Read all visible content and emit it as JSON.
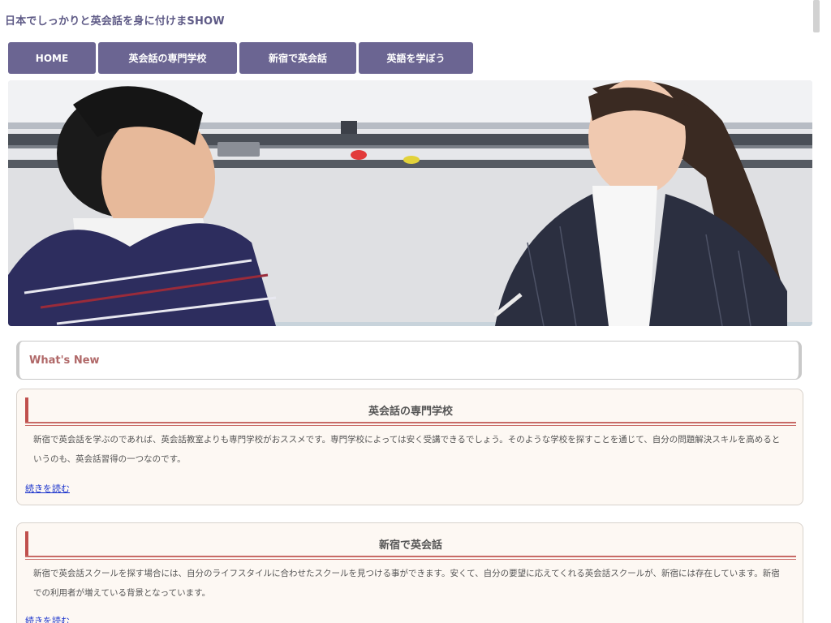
{
  "site": {
    "title": "日本でしっかりと英会話を身に付けまSHOW"
  },
  "nav": [
    {
      "label": "HOME"
    },
    {
      "label": "英会話の専門学校"
    },
    {
      "label": "新宿で英会話"
    },
    {
      "label": "英語を学ぼう"
    }
  ],
  "hero": {
    "image": "two-people-talking-classroom"
  },
  "news": {
    "heading": "What's New"
  },
  "articles": [
    {
      "title": "英会話の専門学校",
      "body": "新宿で英会話を学ぶのであれば、英会話教室よりも専門学校がおススメです。専門学校によっては安く受講できるでしょう。そのような学校を探すことを通じて、自分の問題解決スキルを高めるというのも、英会話習得の一つなのです。",
      "link": "続きを読む"
    },
    {
      "title": "新宿で英会話",
      "body": "新宿で英会話スクールを探す場合には、自分のライフスタイルに合わせたスクールを見つける事ができます。安くて、自分の要望に応えてくれる英会話スクールが、新宿には存在しています。新宿での利用者が増えている背景となっています。",
      "link": "続きを読む"
    }
  ],
  "colors": {
    "nav_bg": "#6b6592",
    "title_color": "#5e5a86",
    "accent_red": "#c0504d",
    "card_bg": "#fdf8f3",
    "link": "#1a33cc"
  }
}
